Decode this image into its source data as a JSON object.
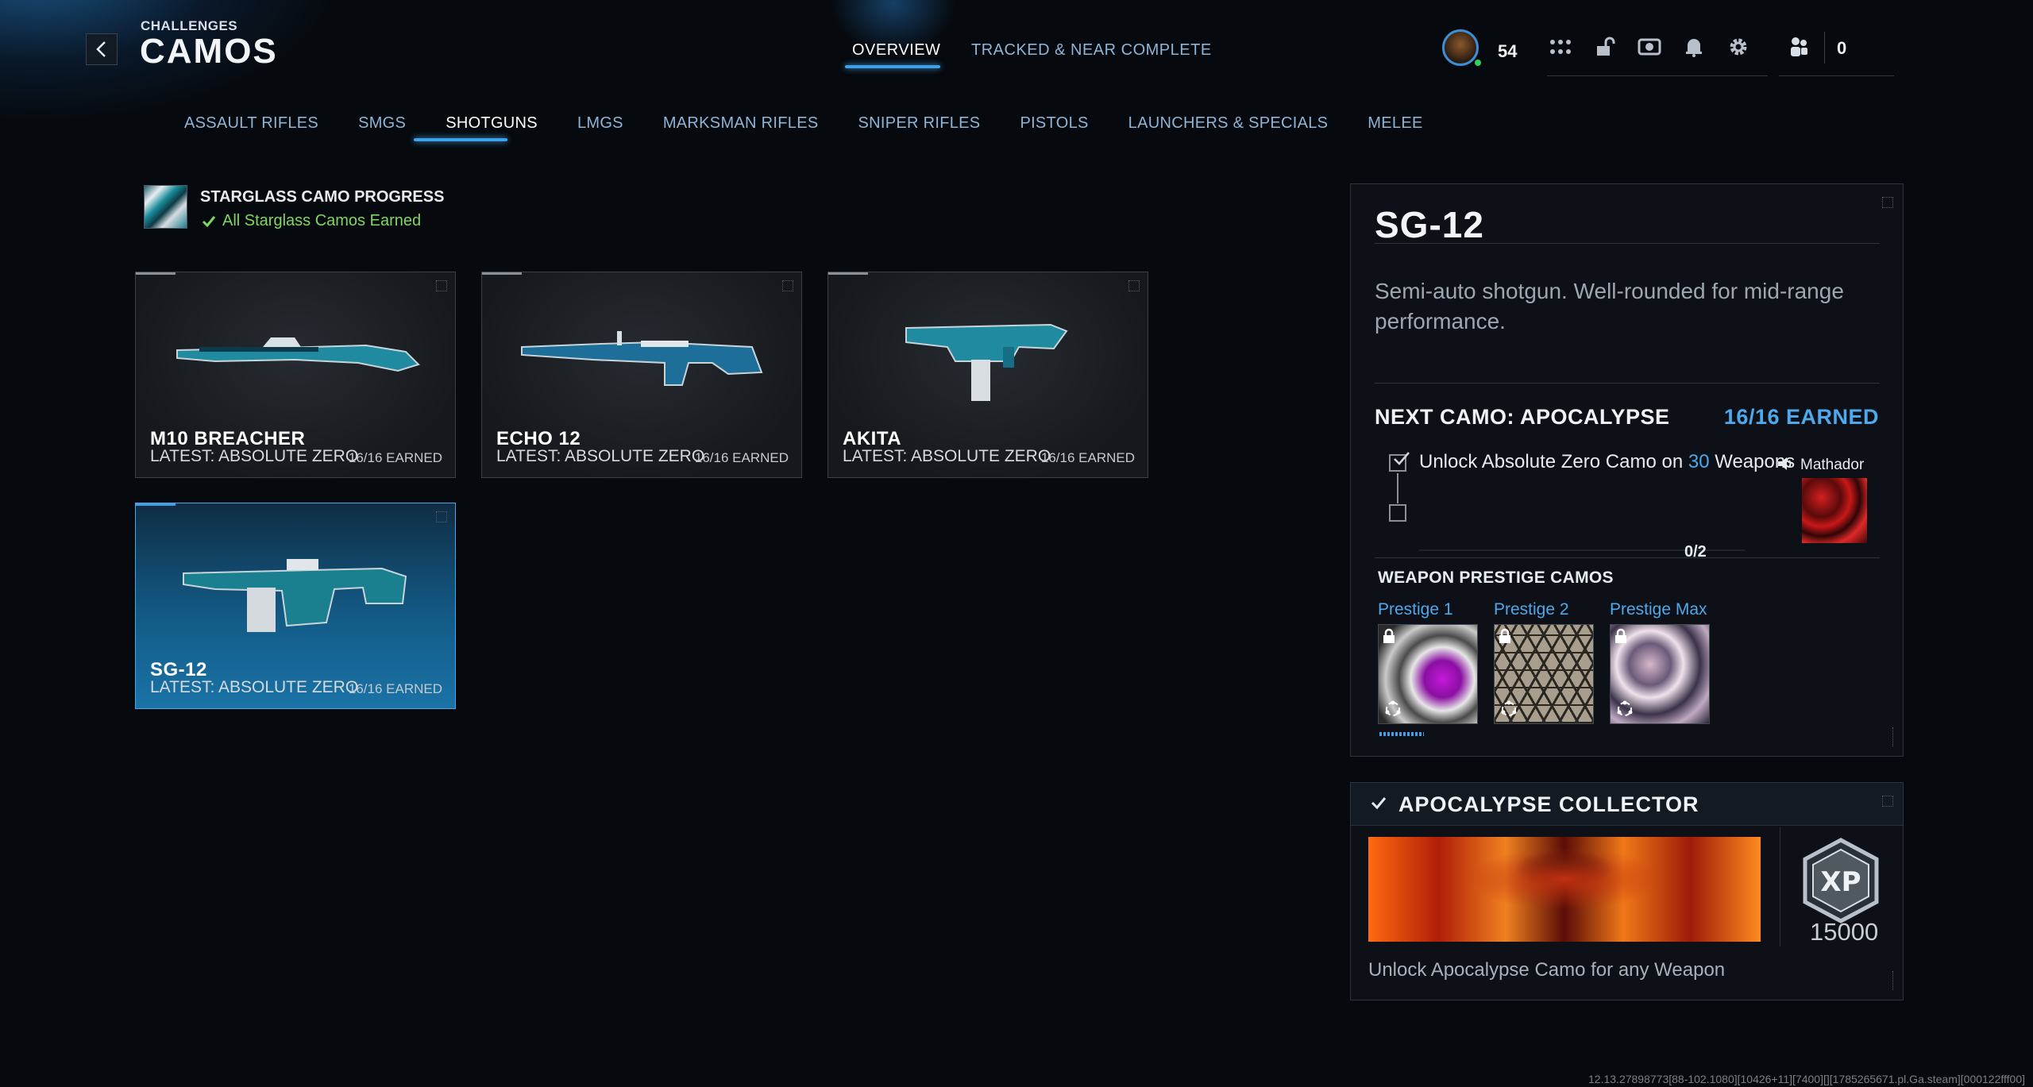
{
  "header": {
    "subtitle": "CHALLENGES",
    "title": "CAMOS",
    "tabs": [
      {
        "label": "OVERVIEW",
        "active": true
      },
      {
        "label": "TRACKED & NEAR COMPLETE",
        "active": false
      }
    ],
    "player_level": "54",
    "friends_count": "0",
    "icons": [
      "apps-grid-icon",
      "unlock-icon",
      "store-icon",
      "notification-bell-icon",
      "settings-gear-icon",
      "friends-icon"
    ]
  },
  "categories": [
    "ASSAULT RIFLES",
    "SMGS",
    "SHOTGUNS",
    "LMGS",
    "MARKSMAN RIFLES",
    "SNIPER RIFLES",
    "PISTOLS",
    "LAUNCHERS & SPECIALS",
    "MELEE"
  ],
  "active_category": "SHOTGUNS",
  "starglass": {
    "title": "STARGLASS CAMO PROGRESS",
    "status": "All Starglass Camos Earned"
  },
  "weapons": [
    {
      "name": "M10 BREACHER",
      "latest": "LATEST: ABSOLUTE ZERO",
      "earned": "16/16 EARNED",
      "selected": false
    },
    {
      "name": "ECHO 12",
      "latest": "LATEST: ABSOLUTE ZERO",
      "earned": "16/16 EARNED",
      "selected": false
    },
    {
      "name": "AKITA",
      "latest": "LATEST: ABSOLUTE ZERO",
      "earned": "16/16 EARNED",
      "selected": false
    },
    {
      "name": "SG-12",
      "latest": "LATEST: ABSOLUTE ZERO",
      "earned": "16/16 EARNED",
      "selected": true
    }
  ],
  "detail": {
    "title": "SG-12",
    "description": "Semi-auto shotgun. Well-rounded for mid-range performance.",
    "next_camo": "NEXT CAMO: APOCALYPSE",
    "earned": "16/16 EARNED",
    "task_prefix": "Unlock Absolute Zero Camo on",
    "task_count": "30",
    "task_suffix": "Weapons",
    "camo_name": "Mathador",
    "progress": "0/2",
    "prestige_title": "WEAPON PRESTIGE CAMOS",
    "prestige": [
      {
        "label": "Prestige 1"
      },
      {
        "label": "Prestige 2"
      },
      {
        "label": "Prestige Max"
      }
    ]
  },
  "collector": {
    "title": "APOCALYPSE COLLECTOR",
    "xp_reward": "15000",
    "description": "Unlock Apocalypse Camo for any Weapon"
  },
  "build_string": "12.13.27898773[88-102.1080][10426+11][7400][][1785265671.pl.Ga.steam][000122fff00]"
}
